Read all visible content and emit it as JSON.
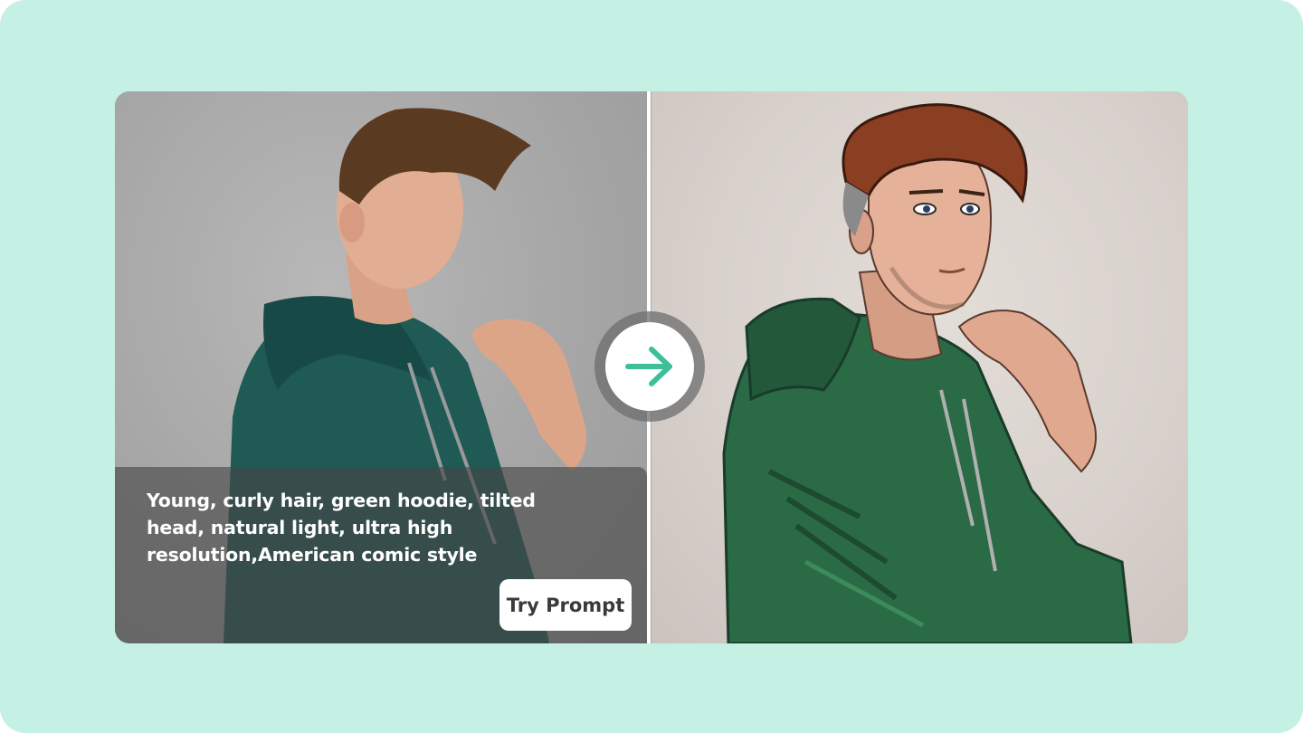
{
  "comparison": {
    "before_image": "photo-portrait",
    "after_image": "comic-portrait",
    "prompt_text": "Young, curly hair, green hoodie, tilted head, natural light, ultra high resolution,American comic style",
    "try_button_label": "Try Prompt",
    "arrow_icon": "arrow-right-icon"
  },
  "colors": {
    "background": "#c5f0e4",
    "accent": "#3dbf9a",
    "hoodie_photo": "#1f5a55",
    "hoodie_comic": "#2a6b45"
  }
}
